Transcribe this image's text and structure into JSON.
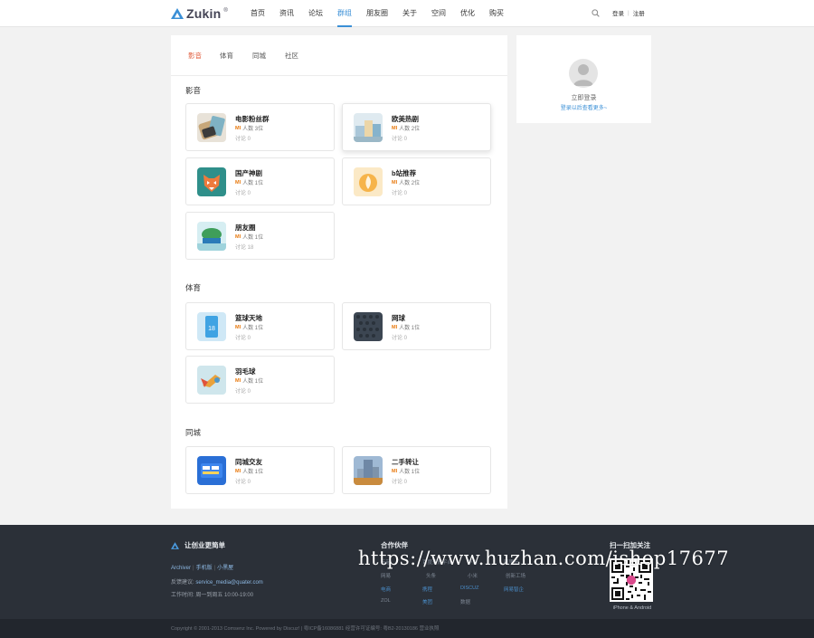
{
  "header": {
    "logo_text": "Zukin",
    "logo_mark": "®",
    "nav": [
      "首页",
      "资讯",
      "论坛",
      "群组",
      "朋友圈",
      "关于",
      "空间",
      "优化",
      "购买"
    ],
    "active_nav": "群组",
    "login": "登录",
    "register": "注册",
    "separator": "|"
  },
  "tabs": [
    "影音",
    "体育",
    "同城",
    "社区"
  ],
  "active_tab": "影音",
  "sections": [
    {
      "title": "影音",
      "groups": [
        {
          "name": "电影粉丝群",
          "brand": "MI",
          "members": "人数 3位",
          "discuss": "讨论 0"
        },
        {
          "name": "欧美热剧",
          "brand": "MI",
          "members": "人数 2位",
          "discuss": "讨论 0"
        },
        {
          "name": "国产神剧",
          "brand": "MI",
          "members": "人数 1位",
          "discuss": "讨论 0"
        },
        {
          "name": "b站推荐",
          "brand": "MI",
          "members": "人数 2位",
          "discuss": "讨论 0"
        },
        {
          "name": "朋友圈",
          "brand": "MI",
          "members": "人数 1位",
          "discuss": "讨论 18"
        }
      ]
    },
    {
      "title": "体育",
      "groups": [
        {
          "name": "篮球天地",
          "brand": "MI",
          "members": "人数 1位",
          "discuss": "讨论 0"
        },
        {
          "name": "网球",
          "brand": "MI",
          "members": "人数 1位",
          "discuss": "讨论 0"
        },
        {
          "name": "羽毛球",
          "brand": "MI",
          "members": "人数 1位",
          "discuss": "讨论 0"
        }
      ]
    },
    {
      "title": "同城",
      "groups": [
        {
          "name": "同城交友",
          "brand": "MI",
          "members": "人数 1位",
          "discuss": "讨论 0"
        },
        {
          "name": "二手转让",
          "brand": "MI",
          "members": "人数 1位",
          "discuss": "讨论 0"
        }
      ]
    }
  ],
  "sidebar": {
    "login_now": "立即登录",
    "login_hint": "登录以后查看更多~"
  },
  "footer": {
    "brand": "让创业更简单",
    "links": [
      "Archiver",
      "手机版",
      "小黑屋"
    ],
    "link_sep": "|",
    "feedback_label": "反馈建议:",
    "feedback_email": "service_media@quater.com",
    "hours": "工作时间: 周一到周五 10:00-19:00",
    "partners_title": "合作伙伴",
    "partners": [
      "云起",
      "百度开放平台",
      "华为",
      "阿里云",
      "网易",
      "头条",
      "小米",
      "创新工场",
      "电商",
      "携程",
      "DISCUZ",
      "网易智企",
      "ZOL",
      "美团",
      "数据"
    ],
    "scan_title": "扫一扫加关注",
    "qr_caption": "iPhone & Android",
    "copyright": "Copyright © 2001-2013 Comsenz Inc. Powered by Discuz! | 粤ICP备16086881 经营许可证编号: 粤B2-20130186 营业执照"
  },
  "watermark": "https://www.huzhan.com/ishop17677",
  "colors": {
    "accent": "#3a8fd6",
    "active_tab": "#e05a3a",
    "brand_badge": "#e8780c",
    "footer_bg": "#2b3038"
  }
}
